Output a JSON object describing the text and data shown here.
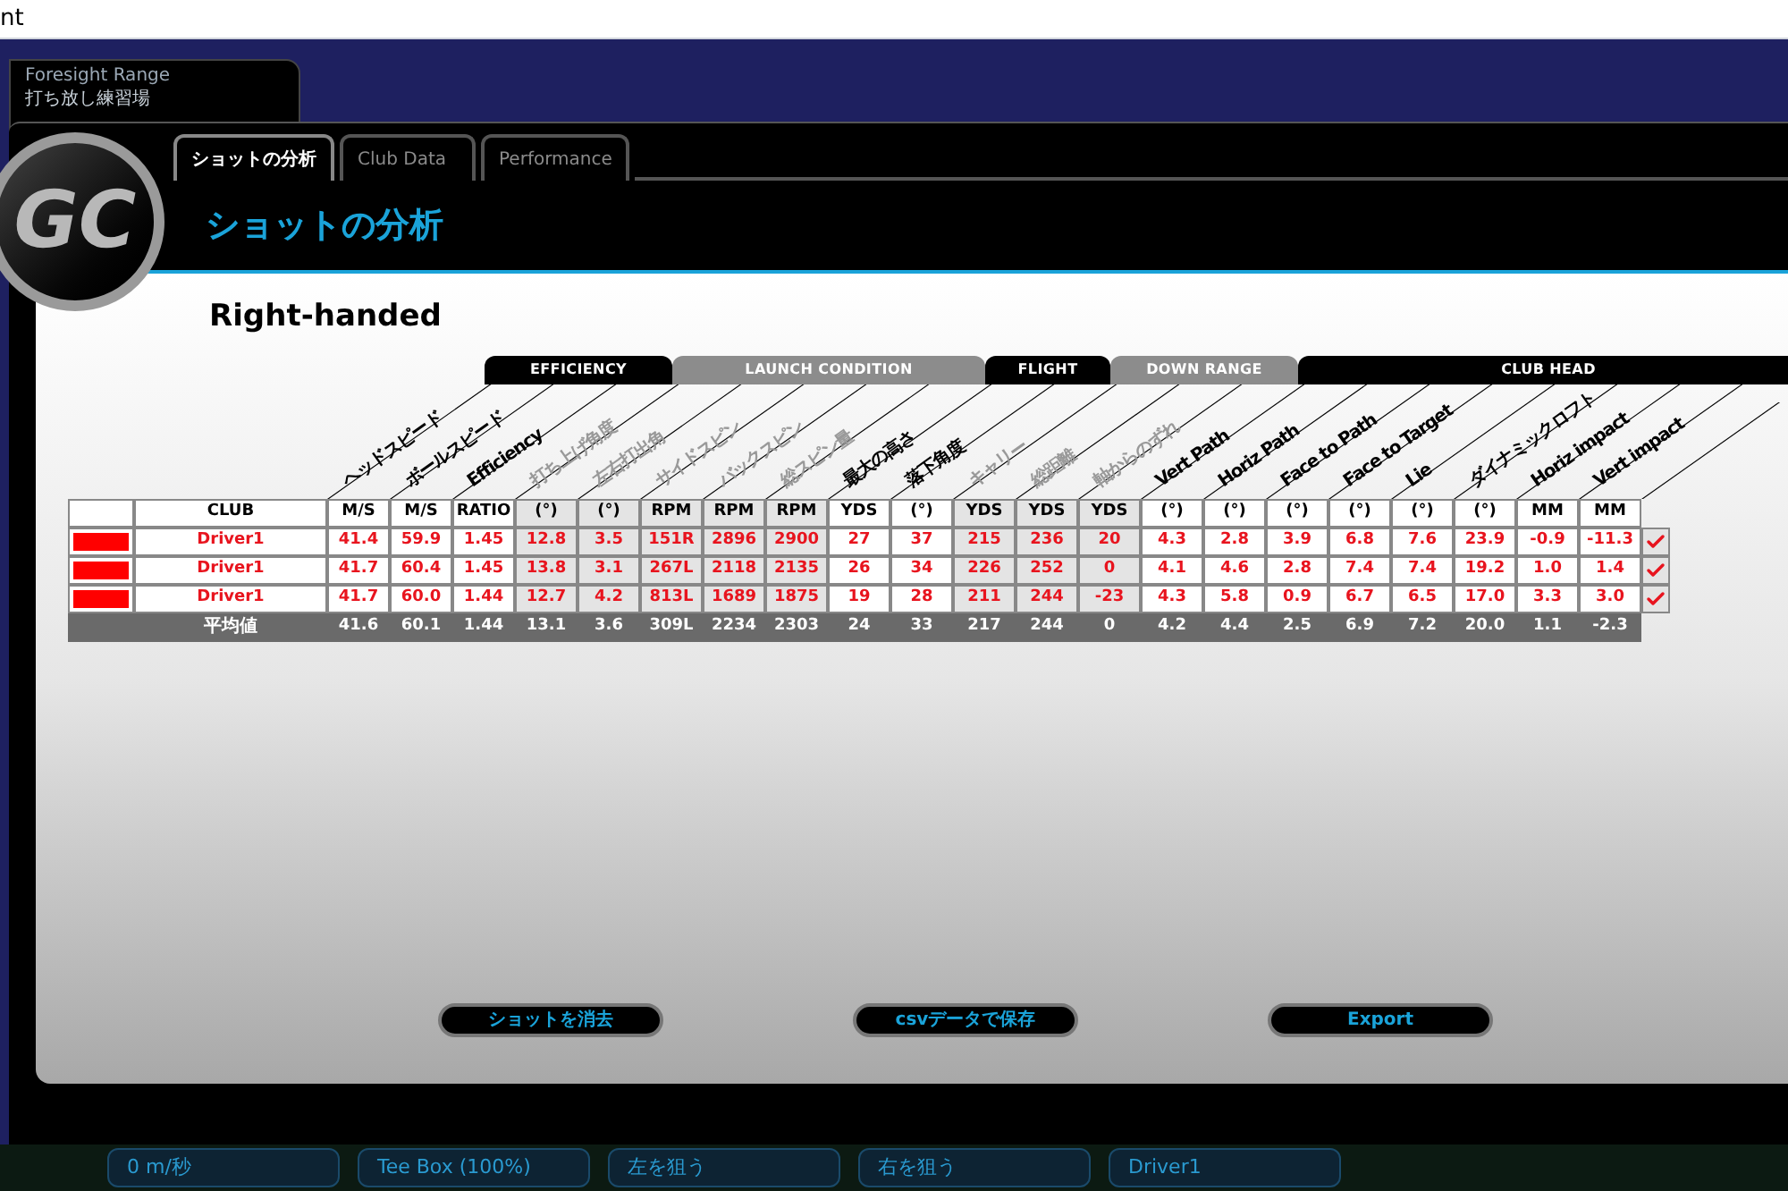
{
  "window": {
    "title": "nt"
  },
  "venue": {
    "name": "Foresight Range",
    "subtitle": "打ち放し練習場"
  },
  "logo": "GC",
  "tabs": [
    {
      "label": "ショットの分析",
      "selected": true
    },
    {
      "label": "Club Data",
      "selected": false
    },
    {
      "label": "Performance",
      "selected": false
    }
  ],
  "page_title": "ショットの分析",
  "handedness": "Right-handed",
  "table": {
    "club_heading": "CLUB",
    "groups": [
      {
        "label": "EFFICIENCY",
        "kind": "dark",
        "columns": [
          {
            "label": "ヘッドスピード",
            "unit": "M/S"
          },
          {
            "label": "ボールスピード",
            "unit": "M/S"
          },
          {
            "label": "Efficiency",
            "unit": "RATIO"
          }
        ]
      },
      {
        "label": "LAUNCH CONDITION",
        "kind": "light",
        "columns": [
          {
            "label": "打ち上げ角度",
            "unit": "(°)"
          },
          {
            "label": "左右打出角",
            "unit": "(°)"
          },
          {
            "label": "サイドスピン",
            "unit": "RPM"
          },
          {
            "label": "バックスピン",
            "unit": "RPM"
          },
          {
            "label": "総スピン量",
            "unit": "RPM"
          }
        ]
      },
      {
        "label": "FLIGHT",
        "kind": "dark",
        "columns": [
          {
            "label": "最大の高さ",
            "unit": "YDS"
          },
          {
            "label": "落下角度",
            "unit": "(°)"
          }
        ]
      },
      {
        "label": "DOWN RANGE",
        "kind": "light",
        "columns": [
          {
            "label": "キャリー",
            "unit": "YDS"
          },
          {
            "label": "総距離",
            "unit": "YDS"
          },
          {
            "label": "軸からのずれ",
            "unit": "YDS"
          }
        ]
      },
      {
        "label": "CLUB HEAD",
        "kind": "dark",
        "columns": [
          {
            "label": "Vert Path",
            "unit": "(°)"
          },
          {
            "label": "Horiz Path",
            "unit": "(°)"
          },
          {
            "label": "Face to Path",
            "unit": "(°)"
          },
          {
            "label": "Face to Target",
            "unit": "(°)"
          },
          {
            "label": "Lie",
            "unit": "(°)"
          },
          {
            "label": "ダイナミックロフト",
            "unit": "(°)"
          },
          {
            "label": "Horiz impact",
            "unit": "MM"
          },
          {
            "label": "Vert impact",
            "unit": "MM"
          }
        ]
      }
    ],
    "rows": [
      {
        "color": "#ff0000",
        "club": "Driver1",
        "checked": true,
        "values": [
          "41.4",
          "59.9",
          "1.45",
          "12.8",
          "3.5",
          "151R",
          "2896",
          "2900",
          "27",
          "37",
          "215",
          "236",
          "20",
          "4.3",
          "2.8",
          "3.9",
          "6.8",
          "7.6",
          "23.9",
          "-0.9",
          "-11.3"
        ]
      },
      {
        "color": "#ff0000",
        "club": "Driver1",
        "checked": true,
        "values": [
          "41.7",
          "60.4",
          "1.45",
          "13.8",
          "3.1",
          "267L",
          "2118",
          "2135",
          "26",
          "34",
          "226",
          "252",
          "0",
          "4.1",
          "4.6",
          "2.8",
          "7.4",
          "7.4",
          "19.2",
          "1.0",
          "1.4"
        ]
      },
      {
        "color": "#ff0000",
        "club": "Driver1",
        "checked": true,
        "values": [
          "41.7",
          "60.0",
          "1.44",
          "12.7",
          "4.2",
          "813L",
          "1689",
          "1875",
          "19",
          "28",
          "211",
          "244",
          "-23",
          "4.3",
          "5.8",
          "0.9",
          "6.7",
          "6.5",
          "17.0",
          "3.3",
          "3.0"
        ]
      }
    ],
    "average": {
      "label": "平均値",
      "values": [
        "41.6",
        "60.1",
        "1.44",
        "13.1",
        "3.6",
        "309L",
        "2234",
        "2303",
        "24",
        "33",
        "217",
        "244",
        "0",
        "4.2",
        "4.4",
        "2.5",
        "6.9",
        "7.2",
        "20.0",
        "1.1",
        "-2.3"
      ]
    }
  },
  "buttons": [
    "ショットを消去",
    "csvデータで保存",
    "Export"
  ],
  "bottom_bar": [
    "0 m/秒",
    "Tee Box (100%)",
    "左を狙う",
    "右を狙う",
    "Driver1"
  ]
}
